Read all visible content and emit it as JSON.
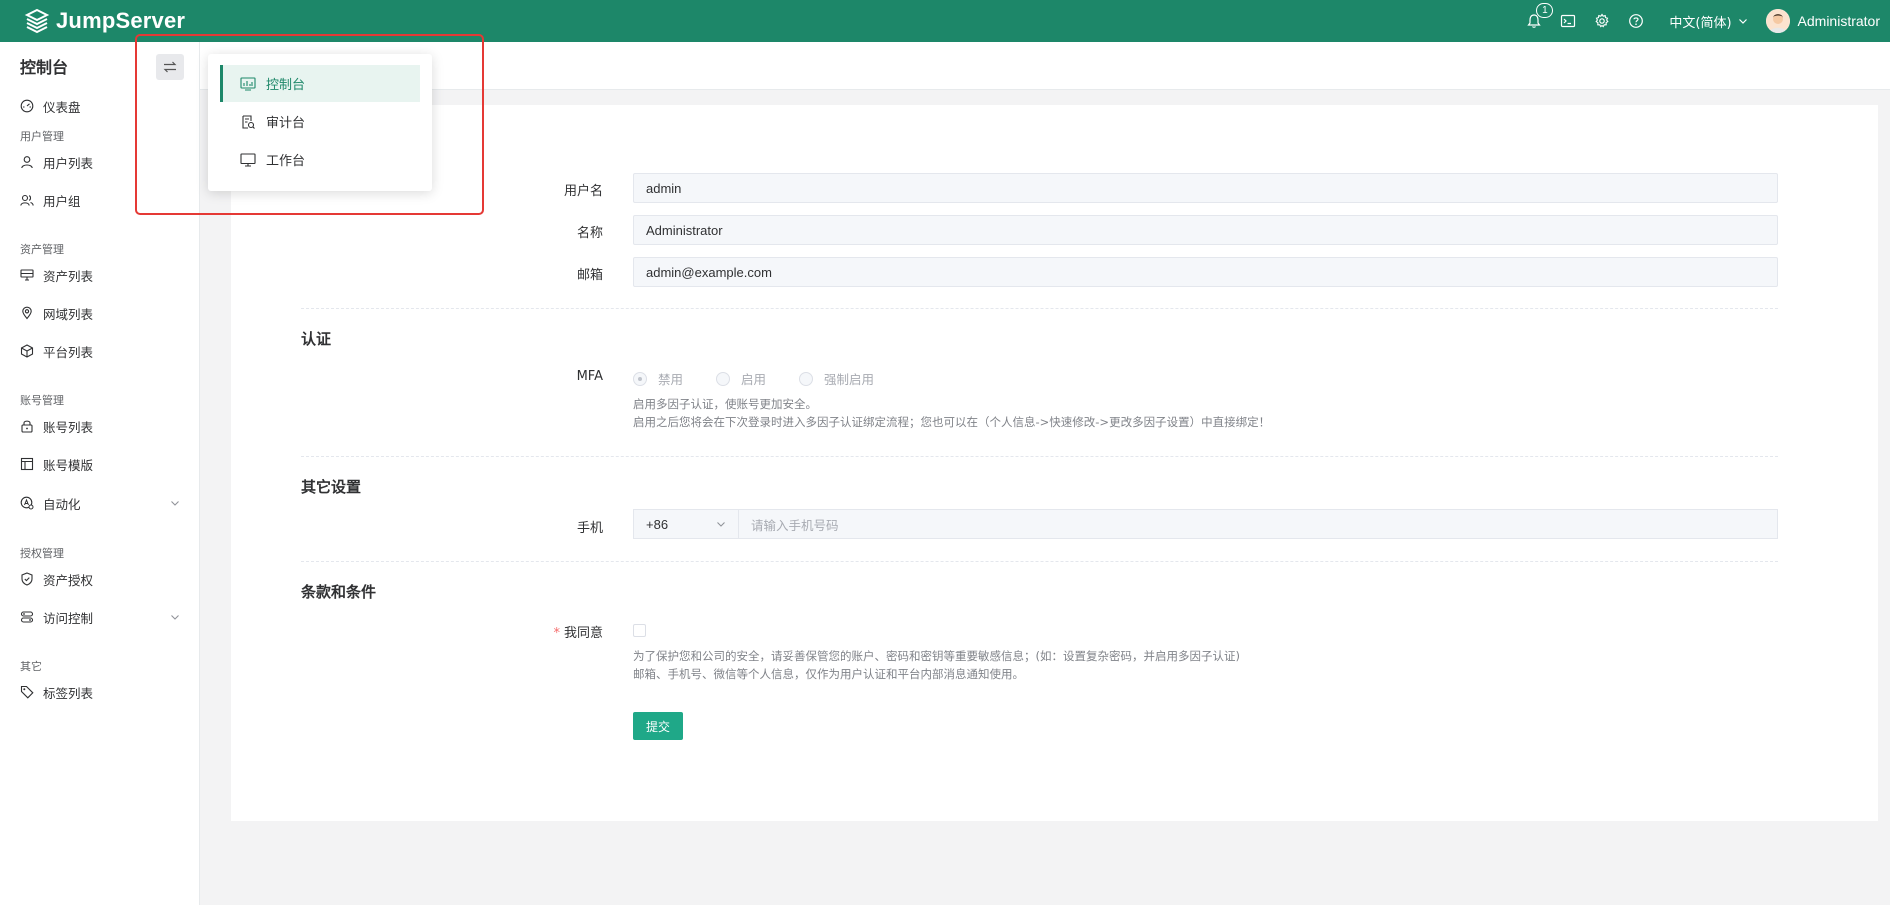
{
  "app": {
    "logo_text": "JumpServer"
  },
  "topbar": {
    "notification_count": "1",
    "language": "中文(简体)",
    "username": "Administrator",
    "icons": [
      "bell-icon",
      "terminal-icon",
      "gear-icon",
      "help-icon"
    ]
  },
  "sidebar": {
    "title": "控制台",
    "items": [
      {
        "label": "仪表盘",
        "icon": "dashboard-icon"
      },
      {
        "group": "用户管理"
      },
      {
        "label": "用户列表",
        "icon": "user-icon"
      },
      {
        "label": "用户组",
        "icon": "users-icon"
      },
      {
        "group": "资产管理"
      },
      {
        "label": "资产列表",
        "icon": "asset-icon"
      },
      {
        "label": "网域列表",
        "icon": "location-icon"
      },
      {
        "label": "平台列表",
        "icon": "box-icon"
      },
      {
        "group": "账号管理"
      },
      {
        "label": "账号列表",
        "icon": "lock-icon"
      },
      {
        "label": "账号模版",
        "icon": "template-icon"
      },
      {
        "label": "自动化",
        "icon": "automation-icon"
      },
      {
        "group": "授权管理"
      },
      {
        "label": "资产授权",
        "icon": "shield-icon"
      },
      {
        "label": "访问控制",
        "icon": "access-icon"
      },
      {
        "group": "其它"
      },
      {
        "label": "标签列表",
        "icon": "tag-icon"
      }
    ]
  },
  "view_switcher": {
    "items": [
      {
        "label": "控制台",
        "icon": "console-icon",
        "active": true
      },
      {
        "label": "审计台",
        "icon": "audit-icon",
        "active": false
      },
      {
        "label": "工作台",
        "icon": "monitor-icon",
        "active": false
      }
    ]
  },
  "form": {
    "username_label": "用户名",
    "username_value": "admin",
    "name_label": "名称",
    "name_value": "Administrator",
    "email_label": "邮箱",
    "email_value": "admin@example.com",
    "auth_section": "认证",
    "mfa_label": "MFA",
    "mfa_options": [
      "禁用",
      "启用",
      "强制启用"
    ],
    "mfa_selected": "禁用",
    "mfa_help_1": "启用多因子认证，使账号更加安全。",
    "mfa_help_2": "启用之后您将会在下次登录时进入多因子认证绑定流程；您也可以在（个人信息->快速修改->更改多因子设置）中直接绑定！",
    "other_section": "其它设置",
    "phone_label": "手机",
    "phone_prefix": "+86",
    "phone_placeholder": "请输入手机号码",
    "terms_section": "条款和条件",
    "agree_required_mark": "*",
    "agree_label": "我同意",
    "terms_help_1": "为了保护您和公司的安全，请妥善保管您的账户、密码和密钥等重要敏感信息；(如：设置复杂密码，并启用多因子认证)",
    "terms_help_2": "邮箱、手机号、微信等个人信息，仅作为用户认证和平台内部消息通知使用。",
    "submit_label": "提交"
  },
  "colors": {
    "brand": "#1d8769",
    "button": "#1fa888",
    "annotation_outline": "#e53935"
  }
}
